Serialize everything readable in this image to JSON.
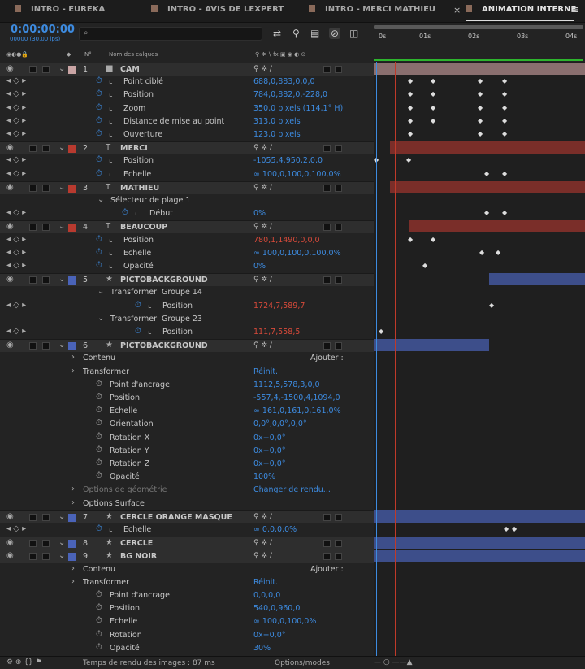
{
  "tabs": [
    {
      "label": "INTRO - EUREKA"
    },
    {
      "label": "INTRO - AVIS DE LEXPERT"
    },
    {
      "label": "INTRO - MERCI MATHIEU"
    },
    {
      "label": "ANIMATION INTERNE"
    }
  ],
  "timecode": "0:00:00:00",
  "fps": "00000 (30.00 ips)",
  "ruler_ticks": [
    "0s",
    "01s",
    "02s",
    "03s",
    "04s"
  ],
  "column_headers": {
    "num": "N°",
    "name": "Nom des calques"
  },
  "rows": [
    {
      "type": "layer",
      "num": "1",
      "name": "CAM",
      "color": "#c9a4a4",
      "icon": "camera"
    },
    {
      "type": "prop",
      "name": "Point ciblé",
      "value": "688,0,883,0,0,0"
    },
    {
      "type": "prop",
      "name": "Position",
      "value": "784,0,882,0,-228,0"
    },
    {
      "type": "prop",
      "name": "Zoom",
      "value": "350,0 pixels (114,1° H)"
    },
    {
      "type": "prop",
      "name": "Distance de mise au point",
      "value": "313,0 pixels"
    },
    {
      "type": "prop",
      "name": "Ouverture",
      "value": "123,0 pixels"
    },
    {
      "type": "layer",
      "num": "2",
      "name": "MERCI",
      "color": "#b83a2f",
      "icon": "text"
    },
    {
      "type": "prop",
      "name": "Position",
      "value": "-1055,4,950,2,0,0"
    },
    {
      "type": "prop",
      "name": "Echelle",
      "value": "∞ 100,0,100,0,100,0%"
    },
    {
      "type": "layer",
      "num": "3",
      "name": "MATHIEU",
      "color": "#b83a2f",
      "icon": "text"
    },
    {
      "type": "group",
      "name": "Sélecteur de plage 1"
    },
    {
      "type": "prop2",
      "name": "Début",
      "value": "0%"
    },
    {
      "type": "layer",
      "num": "4",
      "name": "BEAUCOUP",
      "color": "#b83a2f",
      "icon": "text"
    },
    {
      "type": "prop",
      "name": "Position",
      "value": "780,1,1490,0,0,0",
      "red": true
    },
    {
      "type": "prop",
      "name": "Echelle",
      "value": "∞ 100,0,100,0,100,0%"
    },
    {
      "type": "prop",
      "name": "Opacité",
      "value": "0%"
    },
    {
      "type": "layer",
      "num": "5",
      "name": "PICTOBACKGROUND",
      "color": "#4a63b8",
      "icon": "star"
    },
    {
      "type": "group",
      "name": "Transformer: Groupe 14"
    },
    {
      "type": "prop3",
      "name": "Position",
      "value": "1724,7,589,7",
      "red": true
    },
    {
      "type": "group",
      "name": "Transformer: Groupe 23"
    },
    {
      "type": "prop3",
      "name": "Position",
      "value": "111,7,558,5",
      "red": true
    },
    {
      "type": "layer",
      "num": "6",
      "name": "PICTOBACKGROUND",
      "color": "#4a63b8",
      "icon": "star"
    },
    {
      "type": "section",
      "name": "Contenu",
      "right": "Ajouter :"
    },
    {
      "type": "section",
      "name": "Transformer",
      "right": "Réinit."
    },
    {
      "type": "tprop",
      "name": "Point d'ancrage",
      "value": "1112,5,578,3,0,0"
    },
    {
      "type": "tprop",
      "name": "Position",
      "value": "-557,4,-1500,4,1094,0"
    },
    {
      "type": "tprop",
      "name": "Echelle",
      "value": "∞ 161,0,161,0,161,0%"
    },
    {
      "type": "tprop",
      "name": "Orientation",
      "value": "0,0°,0,0°,0,0°"
    },
    {
      "type": "tprop",
      "name": "Rotation X",
      "value": "0x+0,0°"
    },
    {
      "type": "tprop",
      "name": "Rotation Y",
      "value": "0x+0,0°"
    },
    {
      "type": "tprop",
      "name": "Rotation Z",
      "value": "0x+0,0°"
    },
    {
      "type": "tprop",
      "name": "Opacité",
      "value": "100%"
    },
    {
      "type": "section",
      "name": "Options de géométrie",
      "right": "Changer de rendu...",
      "dim": true
    },
    {
      "type": "section",
      "name": "Options Surface"
    },
    {
      "type": "layer",
      "num": "7",
      "name": "CERCLE ORANGE MASQUE",
      "color": "#4a63b8",
      "icon": "star"
    },
    {
      "type": "prop",
      "name": "Echelle",
      "value": "∞ 0,0,0,0%"
    },
    {
      "type": "layer",
      "num": "8",
      "name": "CERCLE",
      "color": "#4a63b8",
      "icon": "star"
    },
    {
      "type": "layer",
      "num": "9",
      "name": "BG NOIR",
      "color": "#4a63b8",
      "icon": "star"
    },
    {
      "type": "section",
      "name": "Contenu",
      "right": "Ajouter :"
    },
    {
      "type": "section",
      "name": "Transformer",
      "right": "Réinit."
    },
    {
      "type": "tprop",
      "name": "Point d'ancrage",
      "value": "0,0,0,0"
    },
    {
      "type": "tprop",
      "name": "Position",
      "value": "540,0,960,0"
    },
    {
      "type": "tprop",
      "name": "Echelle",
      "value": "∞ 100,0,100,0%"
    },
    {
      "type": "tprop",
      "name": "Rotation",
      "value": "0x+0,0°"
    },
    {
      "type": "tprop",
      "name": "Opacité",
      "value": "30%"
    }
  ],
  "status": {
    "render_time": "Temps de rendu des images : 87 ms",
    "options": "Options/modes"
  },
  "colors": {
    "accent": "#3d8be0",
    "red_value": "#d84a3a",
    "camera_bar": "#8a6f6f",
    "text_bar": "#7a2e29",
    "shape_bar": "#3d4e8a"
  }
}
